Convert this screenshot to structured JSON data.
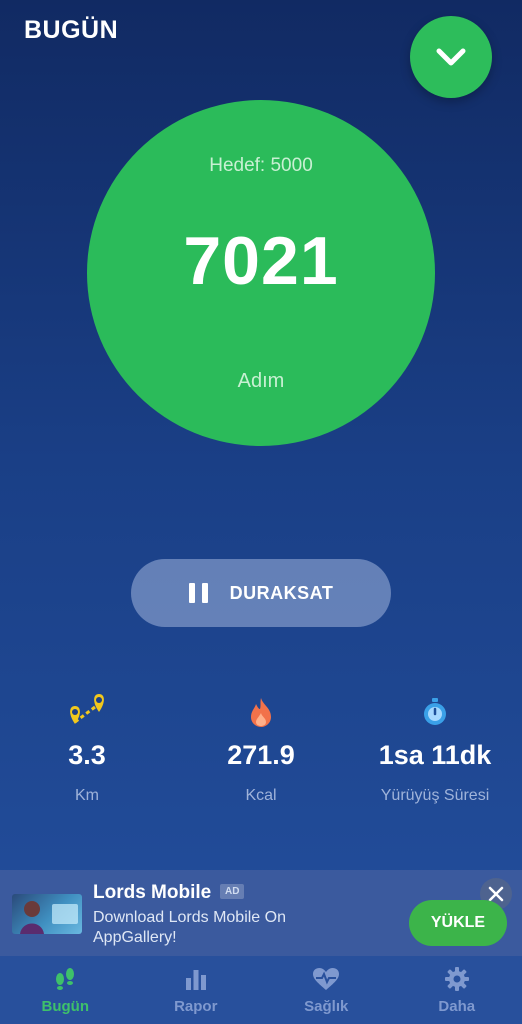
{
  "header": {
    "title": "BUGÜN"
  },
  "fab": {
    "icon": "chevron-down-icon"
  },
  "progress": {
    "goal_label": "Hedef: 5000",
    "steps": "7021",
    "unit": "Adım",
    "goal": 5000,
    "current": 7021
  },
  "pause_button": {
    "label": "DURAKSAT",
    "icon": "pause-icon"
  },
  "stats": [
    {
      "icon": "route-icon",
      "value": "3.3",
      "label": "Km"
    },
    {
      "icon": "flame-icon",
      "value": "271.9",
      "label": "Kcal"
    },
    {
      "icon": "stopwatch-icon",
      "value": "1sa 11dk",
      "label": "Yürüyüş Süresi"
    }
  ],
  "ad": {
    "title": "Lords Mobile",
    "badge": "AD",
    "description": "Download Lords Mobile On AppGallery!",
    "cta": "YÜKLE"
  },
  "nav": [
    {
      "label": "Bugün",
      "icon": "footprints-icon",
      "active": true
    },
    {
      "label": "Rapor",
      "icon": "bar-chart-icon",
      "active": false
    },
    {
      "label": "Sağlık",
      "icon": "heart-pulse-icon",
      "active": false
    },
    {
      "label": "Daha",
      "icon": "gear-icon",
      "active": false
    }
  ],
  "colors": {
    "accent": "#2bbb5a",
    "background_top": "#112a63",
    "background_bottom": "#24509f",
    "nav_active": "#3ec16a",
    "nav_inactive": "#7f99cf"
  }
}
